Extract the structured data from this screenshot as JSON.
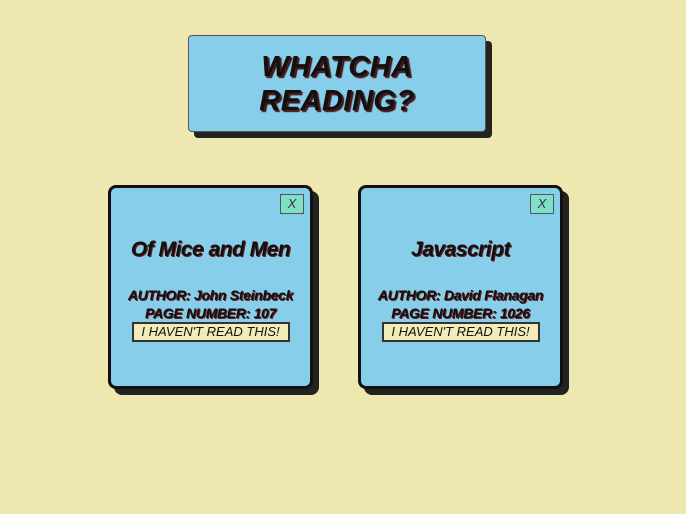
{
  "header": {
    "title": "WHATCHA READING?"
  },
  "books": [
    {
      "close_label": "X",
      "title": "Of Mice and Men",
      "author_line": "AUTHOR: John Steinbeck",
      "pages_line": "PAGE NUMBER: 107",
      "read_button_label": "I HAVEN'T READ THIS!"
    },
    {
      "close_label": "X",
      "title": "Javascript",
      "author_line": "AUTHOR: David Flanagan",
      "pages_line": "PAGE NUMBER: 1026",
      "read_button_label": "I HAVEN'T READ THIS!"
    }
  ],
  "colors": {
    "background": "#eee8b0",
    "card": "#87ceea",
    "close_button": "#7fe0c8",
    "read_button": "#f2ecb8"
  }
}
